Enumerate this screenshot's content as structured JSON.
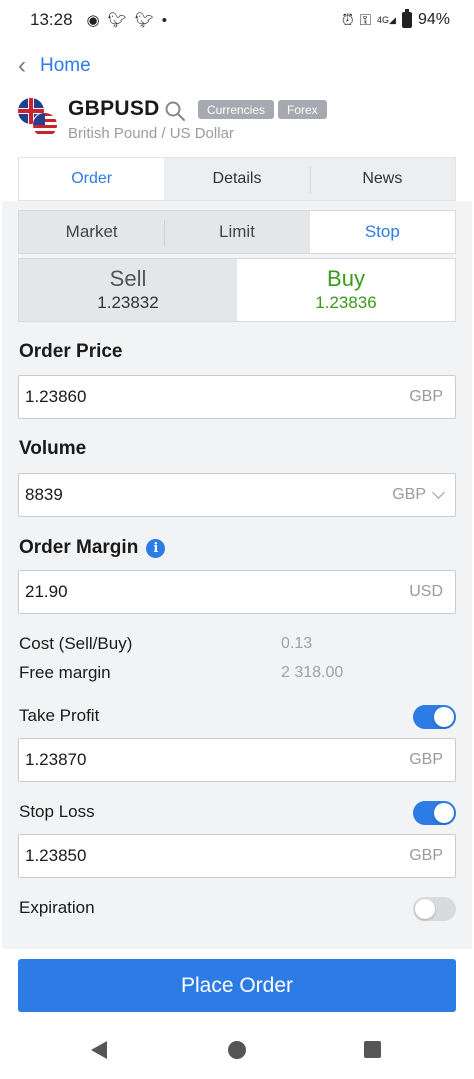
{
  "status_bar": {
    "time": "13:28",
    "notification_icons": [
      "messenger-icon",
      "twitter-icon",
      "twitter-icon",
      "dot-icon"
    ],
    "right_icons": [
      "alarm-icon",
      "vpn-key-icon",
      "signal-4g-icon",
      "battery-icon"
    ],
    "network": "4G",
    "battery": "94%"
  },
  "nav": {
    "back_label": "Home"
  },
  "instrument": {
    "symbol": "GBPUSD",
    "description": "British Pound / US Dollar",
    "tags": [
      "Currencies",
      "Forex"
    ]
  },
  "tabs": [
    {
      "label": "Order",
      "active": true
    },
    {
      "label": "Details",
      "active": false
    },
    {
      "label": "News",
      "active": false
    }
  ],
  "order_types": [
    {
      "label": "Market",
      "active": false
    },
    {
      "label": "Limit",
      "active": false
    },
    {
      "label": "Stop",
      "active": true
    }
  ],
  "sell": {
    "label": "Sell",
    "price": "1.23832"
  },
  "buy": {
    "label": "Buy",
    "price": "1.23836",
    "selected": true
  },
  "order_price": {
    "label": "Order Price",
    "value": "1.23860",
    "unit": "GBP"
  },
  "volume": {
    "label": "Volume",
    "value": "8839",
    "unit": "GBP"
  },
  "order_margin": {
    "label": "Order Margin",
    "value": "21.90",
    "unit": "USD"
  },
  "cost": {
    "label": "Cost (Sell/Buy)",
    "value": "0.13"
  },
  "free_margin": {
    "label": "Free margin",
    "value": "2 318.00"
  },
  "take_profit": {
    "label": "Take Profit",
    "enabled": true,
    "value": "1.23870",
    "unit": "GBP"
  },
  "stop_loss": {
    "label": "Stop Loss",
    "enabled": true,
    "value": "1.23850",
    "unit": "GBP"
  },
  "expiration": {
    "label": "Expiration",
    "enabled": false
  },
  "place_order_label": "Place Order",
  "colors": {
    "accent": "#2d7be5",
    "buy_green": "#3a9a1c",
    "tag_grey": "#a6aab0"
  }
}
